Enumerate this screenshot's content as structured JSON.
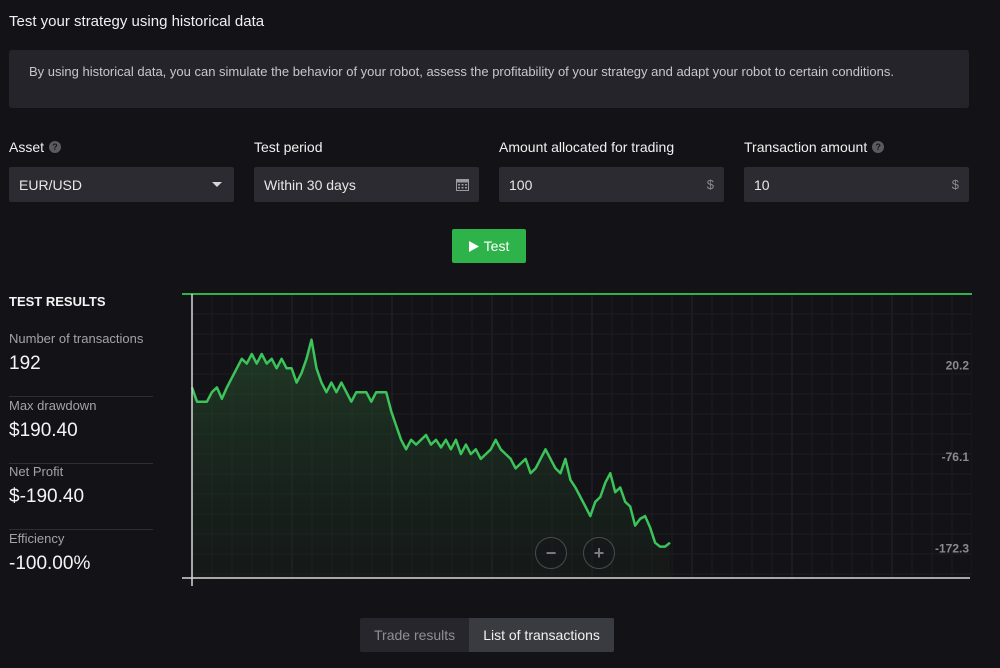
{
  "page": {
    "title": "Test your strategy using historical data",
    "info": "By using historical data, you can simulate the behavior of your robot, assess the profitability of your strategy and adapt your robot to certain conditions."
  },
  "form": {
    "asset": {
      "label": "Asset",
      "value": "EUR/USD"
    },
    "period": {
      "label": "Test period",
      "value": "Within 30 days"
    },
    "allocated": {
      "label": "Amount allocated for trading",
      "value": "100",
      "suffix": "$"
    },
    "transaction": {
      "label": "Transaction amount",
      "value": "10",
      "suffix": "$"
    },
    "help_glyph": "?",
    "test_button": "Test"
  },
  "results": {
    "title": "TEST RESULTS",
    "stats": [
      {
        "label": "Number of transactions",
        "value": "192"
      },
      {
        "label": "Max drawdown",
        "value": "$190.40"
      },
      {
        "label": "Net Profit",
        "value": "$-190.40"
      },
      {
        "label": "Efficiency",
        "value": "-100.00%"
      }
    ]
  },
  "tabs": [
    {
      "label": "Trade results",
      "active": false
    },
    {
      "label": "List of transactions",
      "active": true
    }
  ],
  "zoom": {
    "out": "−",
    "in": "+"
  },
  "colors": {
    "accent": "#2eb34b",
    "line": "#3cc35a",
    "background": "#131317"
  },
  "chart_data": {
    "type": "line",
    "ytick_labels": [
      "20.2",
      "-76.1",
      "-172.3"
    ],
    "ytick_values": [
      20.2,
      -76.1,
      -172.3
    ],
    "ylim": [
      -203,
      95
    ],
    "grid": true,
    "series": [
      {
        "values": [
          -3,
          -18,
          -18,
          -18,
          -8,
          -3,
          -15,
          -3,
          7,
          17,
          27,
          22,
          32,
          22,
          32,
          22,
          27,
          17,
          27,
          17,
          17,
          2,
          12,
          27,
          47,
          17,
          2,
          -8,
          2,
          -8,
          2,
          -8,
          -18,
          -8,
          -8,
          -8,
          -18,
          -8,
          -8,
          -8,
          -28,
          -43,
          -58,
          -68,
          -58,
          -63,
          -58,
          -53,
          -63,
          -58,
          -66,
          -58,
          -68,
          -58,
          -73,
          -63,
          -73,
          -68,
          -78,
          -73,
          -68,
          -58,
          -68,
          -73,
          -78,
          -88,
          -83,
          -78,
          -93,
          -88,
          -78,
          -68,
          -78,
          -88,
          -93,
          -78,
          -100,
          -108,
          -118,
          -128,
          -138,
          -123,
          -118,
          -103,
          -93,
          -113,
          -108,
          -123,
          -128,
          -148,
          -141,
          -138,
          -150,
          -166,
          -170,
          -170,
          -166
        ]
      }
    ]
  }
}
